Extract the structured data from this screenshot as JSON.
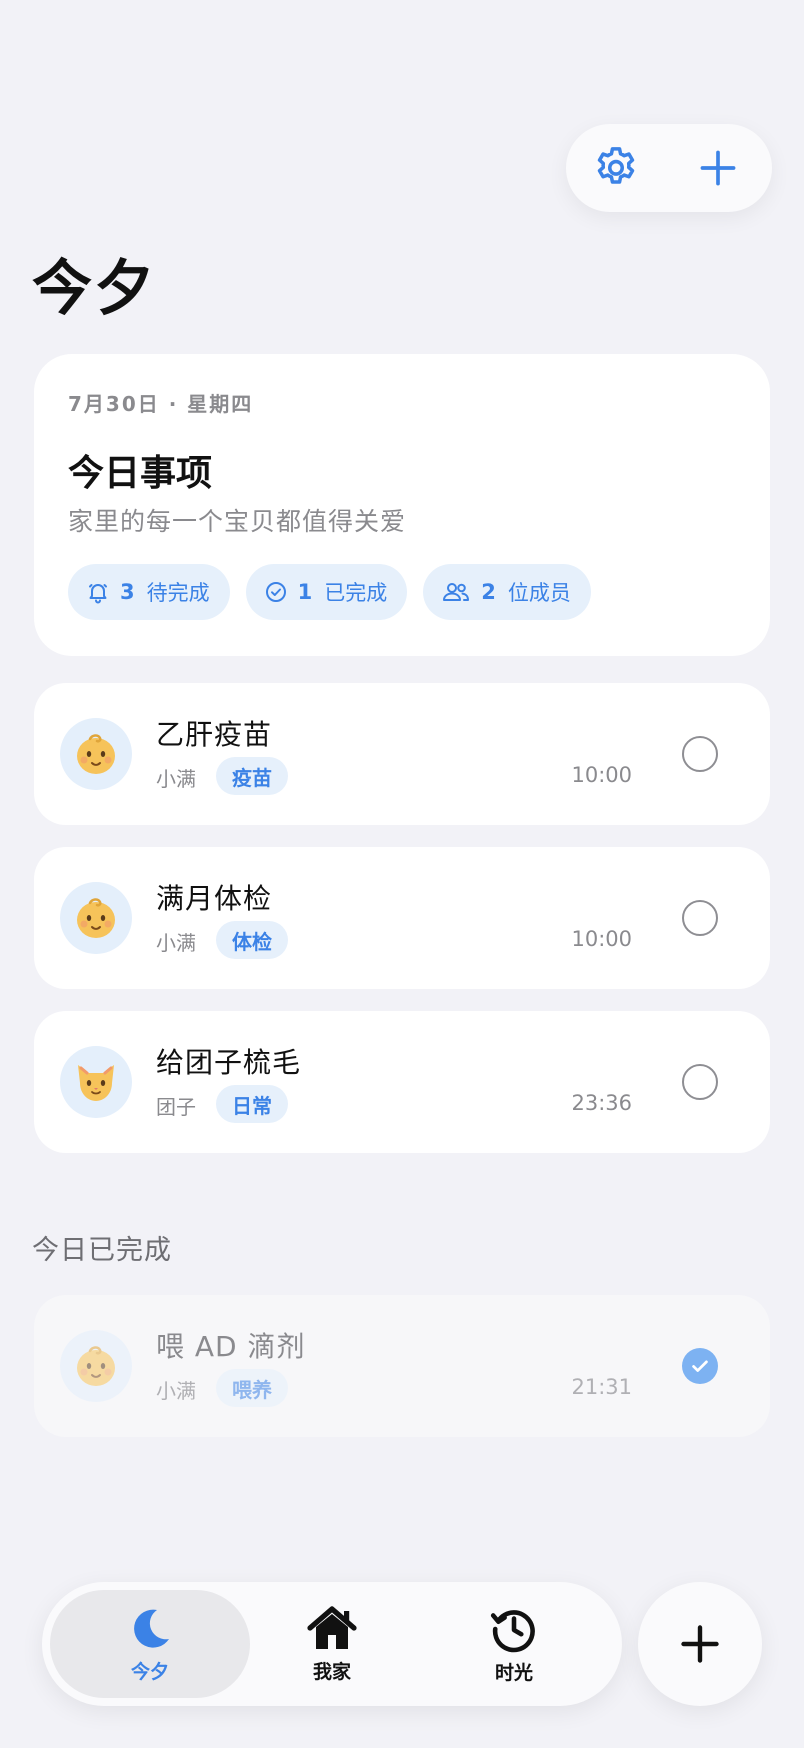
{
  "app": {
    "title": "今夕"
  },
  "toolbar": {
    "settings_icon": "gear-icon",
    "add_icon": "plus-icon"
  },
  "summary": {
    "date": "7月30日 · 星期四",
    "heading": "今日事项",
    "subtitle": "家里的每一个宝贝都值得关爱",
    "chips": [
      {
        "icon": "bell-icon",
        "count": "3",
        "label": "待完成"
      },
      {
        "icon": "check-circle-icon",
        "count": "1",
        "label": "已完成"
      },
      {
        "icon": "people-icon",
        "count": "2",
        "label": "位成员"
      }
    ]
  },
  "tasks": [
    {
      "title": "乙肝疫苗",
      "person": "小满",
      "tag": "疫苗",
      "time": "10:00",
      "avatar": "baby-icon",
      "done": false
    },
    {
      "title": "满月体检",
      "person": "小满",
      "tag": "体检",
      "time": "10:00",
      "avatar": "baby-icon",
      "done": false
    },
    {
      "title": "给团子梳毛",
      "person": "团子",
      "tag": "日常",
      "time": "23:36",
      "avatar": "cat-icon",
      "done": false
    }
  ],
  "completed_section": {
    "title": "今日已完成",
    "items": [
      {
        "title": "喂 AD 滴剂",
        "person": "小满",
        "tag": "喂养",
        "time": "21:31",
        "avatar": "baby-icon",
        "done": true
      }
    ]
  },
  "tabbar": {
    "tabs": [
      {
        "label": "今夕",
        "icon": "moon-icon",
        "active": true
      },
      {
        "label": "我家",
        "icon": "house-icon",
        "active": false
      },
      {
        "label": "时光",
        "icon": "history-clock-icon",
        "active": false
      }
    ],
    "fab_icon": "plus-icon"
  },
  "colors": {
    "accent": "#3b82e6",
    "background": "#f2f2f7",
    "chip_bg": "#e6f0fb"
  }
}
